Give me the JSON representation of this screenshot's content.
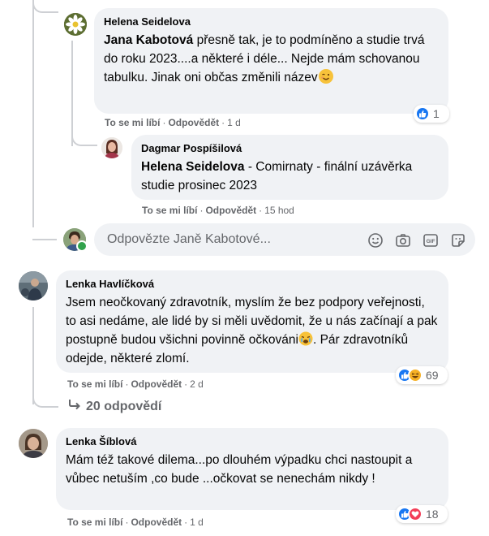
{
  "thread": {
    "reply1": {
      "author": "Helena Seidelova",
      "mention": "Jana Kabotová",
      "text": " přesně tak, je to podmíněno a studie trvá do roku 2023....a některé i déle... Nejde mám schovanou tabulku. Jinak oni občas změnili název",
      "emoji": "winking-face",
      "like_label": "To se mi líbí",
      "reply_label": "Odpovědět",
      "time": "1 d",
      "reactions": [
        "like"
      ],
      "reaction_count": "1"
    },
    "reply2": {
      "author": "Dagmar Pospíšilová",
      "mention": "Helena Seidelova",
      "text": " - Comirnaty - finální uzávěrka studie prosinec 2023",
      "like_label": "To se mi líbí",
      "reply_label": "Odpovědět",
      "time": "15 hod"
    },
    "reply_input": {
      "placeholder": "Odpovězte Janě Kabotové...",
      "icons": [
        "smiley-icon",
        "camera-icon",
        "gif-icon",
        "sticker-icon"
      ]
    }
  },
  "comment1": {
    "author": "Lenka Havlíčková",
    "text": "Jsem neočkovaný zdravotník, myslím že bez podpory veřejnosti, to asi nedáme, ale lidé by si měli uvědomit, že u nás začínají a pak postupně budou všichni povinně očkováni",
    "emoji": "crying-face",
    "text_after": ". Pár zdravotníků odejde, některé zlomí.",
    "like_label": "To se mi líbí",
    "reply_label": "Odpovědět",
    "time": "2 d",
    "reactions": [
      "like",
      "haha"
    ],
    "reaction_count": "69",
    "more_replies": "20 odpovědí"
  },
  "comment2": {
    "author": "Lenka Šíblová",
    "text": "Mám též takové dilema...po dlouhém výpadku chci nastoupit a vůbec netuším ,co bude ...očkovat se nenechám nikdy !",
    "like_label": "To se mi líbí",
    "reply_label": "Odpovědět",
    "time": "1 d",
    "reactions": [
      "like",
      "love"
    ],
    "reaction_count": "18"
  },
  "colors": {
    "bubble": "#f0f2f5",
    "secondary_text": "#65676b",
    "like_blue": "#1877f2",
    "love_red": "#f33e58",
    "online_green": "#31a24c"
  }
}
